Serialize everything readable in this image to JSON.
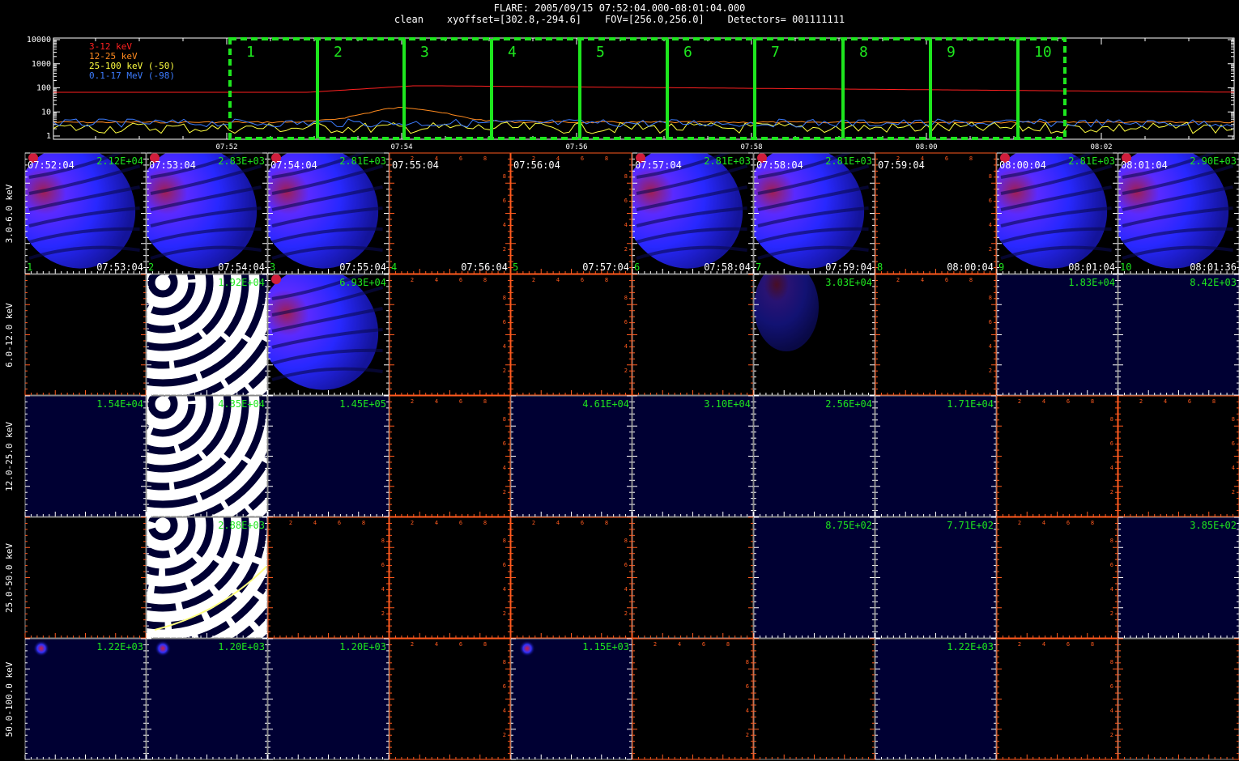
{
  "header": {
    "line1": "FLARE: 2005/09/15 07:52:04.000-08:01:04.000",
    "line2": "clean    xyoffset=[302.8,-294.6]    FOV=[256.0,256.0]    Detectors= 001111111"
  },
  "lightcurve": {
    "y_ticks": [
      "10000",
      "1000",
      "100",
      "10",
      "1"
    ],
    "x_ticks": [
      "07:52",
      "07:54",
      "07:56",
      "07:58",
      "08:00",
      "08:02"
    ],
    "legend": [
      {
        "label": "3-12 keV",
        "color": "#ff2020"
      },
      {
        "label": "12-25 keV",
        "color": "#ff8a1e"
      },
      {
        "label": "25-100 keV (-50)",
        "color": "#ffff40"
      },
      {
        "label": "0.1-17 MeV (-98)",
        "color": "#3c7cff"
      }
    ],
    "interval_labels": [
      "1",
      "2",
      "3",
      "4",
      "5",
      "6",
      "7",
      "8",
      "9",
      "10"
    ],
    "interval_color": "#1ee61e"
  },
  "bands": [
    "3.0-6.0 keV",
    "6.0-12.0 keV",
    "12.0-25.0 keV",
    "25.0-50.0 keV",
    "50.0-100.0 keV"
  ],
  "time_bins": [
    {
      "start": "07:52:04",
      "end": "07:53:04",
      "index": "1"
    },
    {
      "start": "07:53:04",
      "end": "07:54:04",
      "index": "2"
    },
    {
      "start": "07:54:04",
      "end": "07:55:04",
      "index": "3"
    },
    {
      "start": "07:55:04",
      "end": "07:56:04",
      "index": "4"
    },
    {
      "start": "07:56:04",
      "end": "07:57:04",
      "index": "5"
    },
    {
      "start": "07:57:04",
      "end": "07:58:04",
      "index": "6"
    },
    {
      "start": "07:58:04",
      "end": "07:59:04",
      "index": "7"
    },
    {
      "start": "07:59:04",
      "end": "08:00:04",
      "index": "8"
    },
    {
      "start": "08:00:04",
      "end": "08:01:04",
      "index": "9"
    },
    {
      "start": "08:01:04",
      "end": "08:01:36",
      "index": "10"
    }
  ],
  "cells": [
    [
      {
        "kind": "blue",
        "value": "2.12E+04"
      },
      {
        "kind": "blue2",
        "value": "2.83E+03"
      },
      {
        "kind": "blue",
        "value": "2.81E+03"
      },
      {
        "kind": "empty",
        "value": ""
      },
      {
        "kind": "empty",
        "value": ""
      },
      {
        "kind": "blue",
        "value": "2.81E+03"
      },
      {
        "kind": "blue",
        "value": "2.81E+03"
      },
      {
        "kind": "empty",
        "value": ""
      },
      {
        "kind": "blue2",
        "value": "2.81E+03"
      },
      {
        "kind": "blue2",
        "value": "2.90E+03"
      }
    ],
    [
      {
        "kind": "black",
        "value": ""
      },
      {
        "kind": "rings",
        "value": "1.92E+04"
      },
      {
        "kind": "blue",
        "value": "6.93E+04"
      },
      {
        "kind": "empty",
        "value": ""
      },
      {
        "kind": "empty",
        "value": ""
      },
      {
        "kind": "black",
        "value": ""
      },
      {
        "kind": "faint",
        "value": "3.03E+04"
      },
      {
        "kind": "empty",
        "value": ""
      },
      {
        "kind": "dim",
        "value": "1.83E+04"
      },
      {
        "kind": "dim",
        "value": "8.42E+03"
      }
    ],
    [
      {
        "kind": "dim",
        "value": "1.54E+04"
      },
      {
        "kind": "rings",
        "value": "4.35E+04"
      },
      {
        "kind": "dim",
        "value": "1.45E+05"
      },
      {
        "kind": "empty",
        "value": ""
      },
      {
        "kind": "dim",
        "value": "4.61E+04"
      },
      {
        "kind": "dim",
        "value": "3.10E+04"
      },
      {
        "kind": "dim",
        "value": "2.56E+04"
      },
      {
        "kind": "dim",
        "value": "1.71E+04"
      },
      {
        "kind": "empty",
        "value": ""
      },
      {
        "kind": "empty",
        "value": ""
      }
    ],
    [
      {
        "kind": "black",
        "value": ""
      },
      {
        "kind": "rings2",
        "value": "2.88E+03"
      },
      {
        "kind": "empty",
        "value": ""
      },
      {
        "kind": "empty",
        "value": ""
      },
      {
        "kind": "empty",
        "value": ""
      },
      {
        "kind": "black",
        "value": ""
      },
      {
        "kind": "dim",
        "value": "8.75E+02"
      },
      {
        "kind": "dim",
        "value": "7.71E+02"
      },
      {
        "kind": "empty",
        "value": ""
      },
      {
        "kind": "dim",
        "value": "3.85E+02"
      }
    ],
    [
      {
        "kind": "spot",
        "value": "1.22E+03"
      },
      {
        "kind": "spot",
        "value": "1.20E+03"
      },
      {
        "kind": "dim",
        "value": "1.20E+03"
      },
      {
        "kind": "empty",
        "value": ""
      },
      {
        "kind": "spot",
        "value": "1.15E+03"
      },
      {
        "kind": "empty",
        "value": ""
      },
      {
        "kind": "black",
        "value": ""
      },
      {
        "kind": "dim",
        "value": "1.22E+03"
      },
      {
        "kind": "empty",
        "value": ""
      },
      {
        "kind": "black",
        "value": ""
      }
    ]
  ],
  "empty_panel_ticks": [
    "2",
    "4",
    "6",
    "8"
  ],
  "colors": {
    "grid_tick": "#ff5a1e",
    "value_text": "#1ee61e",
    "image_blue": "#2828ff",
    "image_red": "#c81e3c",
    "dim_background": "#000033"
  }
}
